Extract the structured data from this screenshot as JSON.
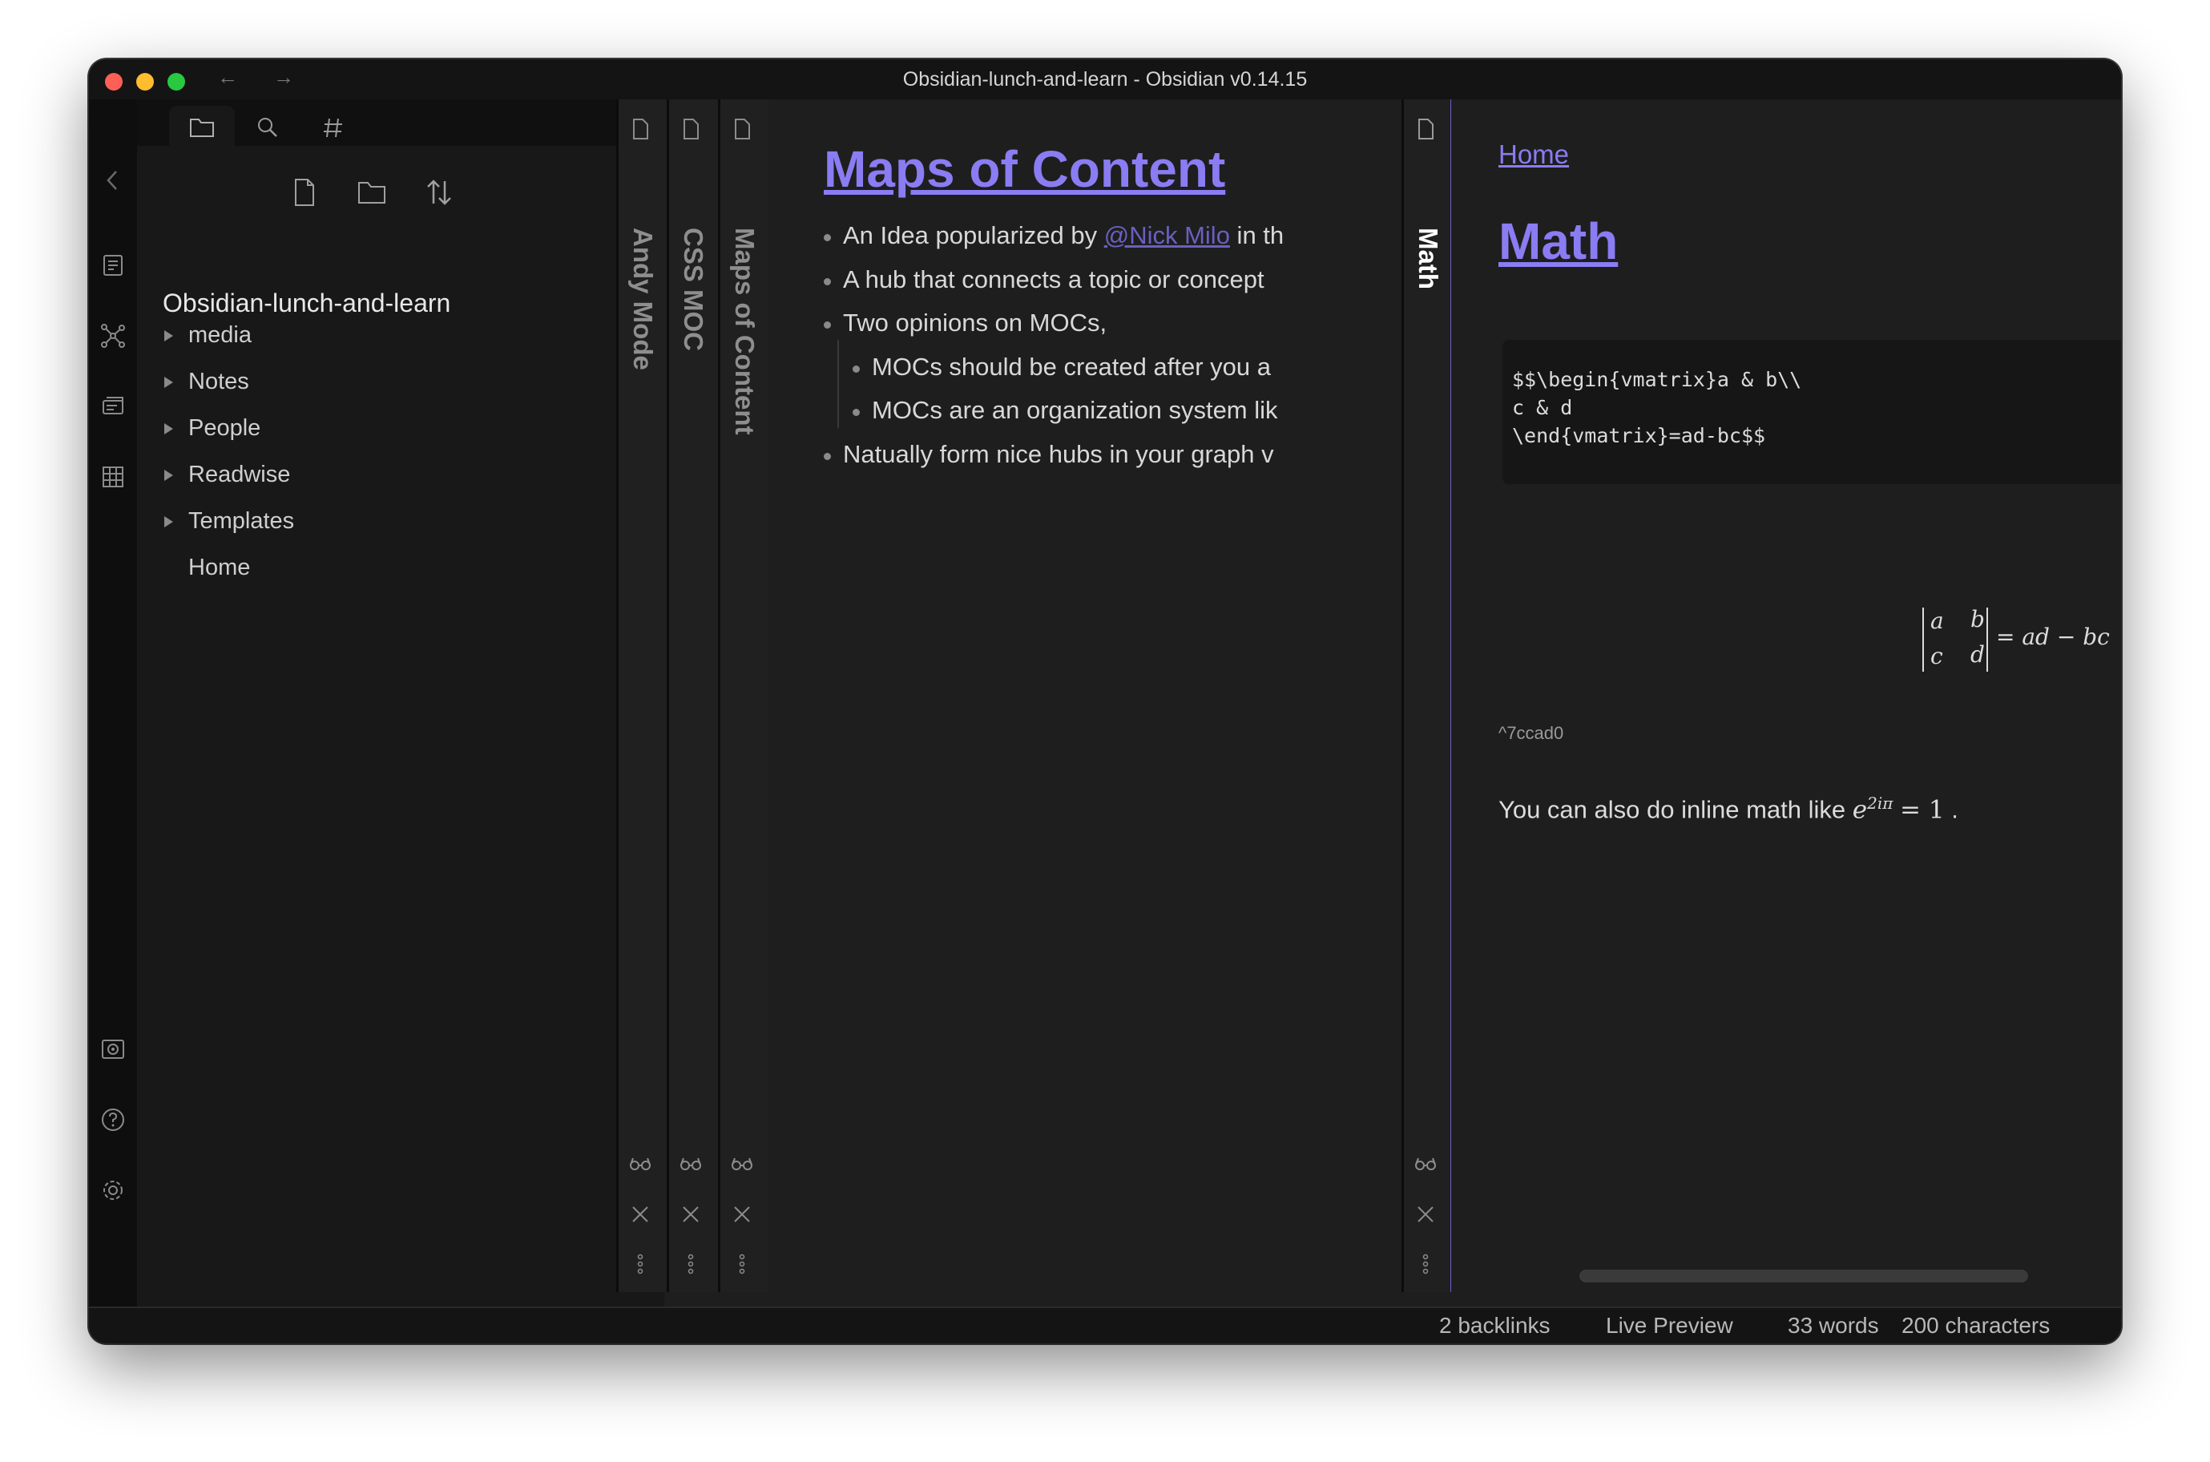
{
  "window": {
    "title": "Obsidian-lunch-and-learn - Obsidian v0.14.15"
  },
  "colors": {
    "accent": "#8a7cf2",
    "link_muted": "#6a5fc2",
    "background": "#1e1e1e",
    "ribbon": "#0e0e0e"
  },
  "ribbon": {
    "icons": [
      "collapse-left-icon",
      "quick-switcher-icon",
      "graph-view-icon",
      "slides-icon",
      "calendar-grid-icon",
      "vault-icon",
      "help-icon",
      "settings-icon"
    ]
  },
  "sidebar": {
    "tabs": [
      "folder-icon",
      "search-icon",
      "tags-icon"
    ],
    "actions": [
      "new-note-icon",
      "new-folder-icon",
      "sort-icon"
    ],
    "vault_name": "Obsidian-lunch-and-learn",
    "tree": [
      {
        "label": "media",
        "type": "folder"
      },
      {
        "label": "Notes",
        "type": "folder"
      },
      {
        "label": "People",
        "type": "folder"
      },
      {
        "label": "Readwise",
        "type": "folder"
      },
      {
        "label": "Templates",
        "type": "folder"
      },
      {
        "label": "Home",
        "type": "file"
      }
    ]
  },
  "stacked_tabs": [
    {
      "title": "Andy Mode"
    },
    {
      "title": "CSS MOC"
    },
    {
      "title": "Maps of Content"
    }
  ],
  "moc_pane": {
    "heading": "Maps of Content",
    "bullets": [
      {
        "before": "An Idea popularized by ",
        "link": "@Nick Milo",
        "after": " in th"
      },
      {
        "text": "A hub that connects a topic or concept"
      },
      {
        "text": "Two opinions on MOCs,"
      },
      {
        "text": "MOCs should be created after you a",
        "indent": true
      },
      {
        "text": "MOCs are an organization system lik",
        "indent": true
      },
      {
        "text": "Natually form nice hubs in your graph v"
      }
    ]
  },
  "math_pane": {
    "tab_title": "Math",
    "breadcrumb": "Home",
    "heading": "Math",
    "code_lines": [
      "$$\\begin{vmatrix}a & b\\\\",
      "c & d",
      "\\end{vmatrix}=ad-bc$$"
    ],
    "matrix": {
      "a": "a",
      "b": "b",
      "c": "c",
      "d": "d",
      "rhs": "= ad − bc"
    },
    "block_id": "^7ccad0",
    "inline_text": "You can also do inline math like",
    "inline_math_base": "e",
    "inline_math_exp": "2iπ",
    "inline_math_rhs": "= 1",
    "inline_end": "."
  },
  "status_bar": {
    "backlinks": "2 backlinks",
    "mode": "Live Preview",
    "words": "33 words",
    "characters": "200 characters"
  }
}
